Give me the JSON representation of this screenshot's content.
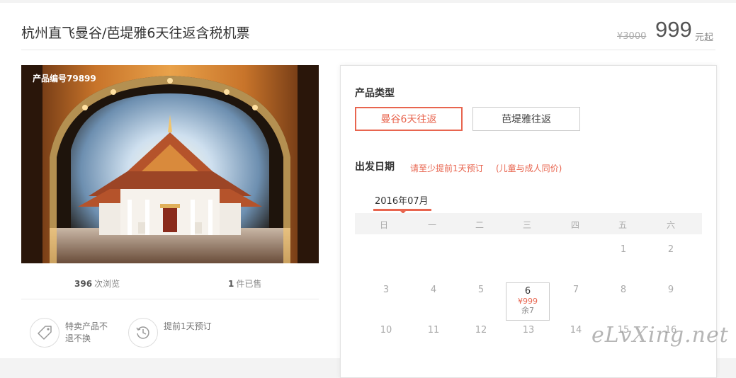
{
  "header": {
    "title": "杭州直飞曼谷/芭堤雅6天往返含税机票",
    "original_price": "¥3000",
    "price": "999",
    "price_unit": "元起"
  },
  "gallery": {
    "product_code": "产品编号79899"
  },
  "stats": {
    "views_count": "396",
    "views_label": "次浏览",
    "sold_count": "1",
    "sold_label": "件已售"
  },
  "features": [
    {
      "icon": "tag-icon",
      "text": "特卖产品不退不换"
    },
    {
      "icon": "clock-history-icon",
      "text": "提前1天预订"
    }
  ],
  "booking": {
    "type_label": "产品类型",
    "types": [
      {
        "label": "曼谷6天往返",
        "selected": true
      },
      {
        "label": "芭堤雅往返",
        "selected": false
      }
    ],
    "date_label": "出发日期",
    "hint_advance": "请至少提前1天预订",
    "hint_child": "(儿童与成人同价)",
    "month": "2016年07月",
    "weekdays": [
      "日",
      "一",
      "二",
      "三",
      "四",
      "五",
      "六"
    ],
    "rows": [
      [
        "",
        "",
        "",
        "",
        "",
        "1",
        "2"
      ],
      [
        "3",
        "4",
        "5",
        "6",
        "7",
        "8",
        "9"
      ],
      [
        "10",
        "11",
        "12",
        "13",
        "14",
        "15",
        "16"
      ]
    ],
    "priced_day": {
      "day": "6",
      "price": "¥999",
      "remaining": "余7"
    }
  },
  "watermark": "eLvXing.net",
  "colors": {
    "accent": "#e8654f",
    "muted": "#aaaaaa"
  }
}
